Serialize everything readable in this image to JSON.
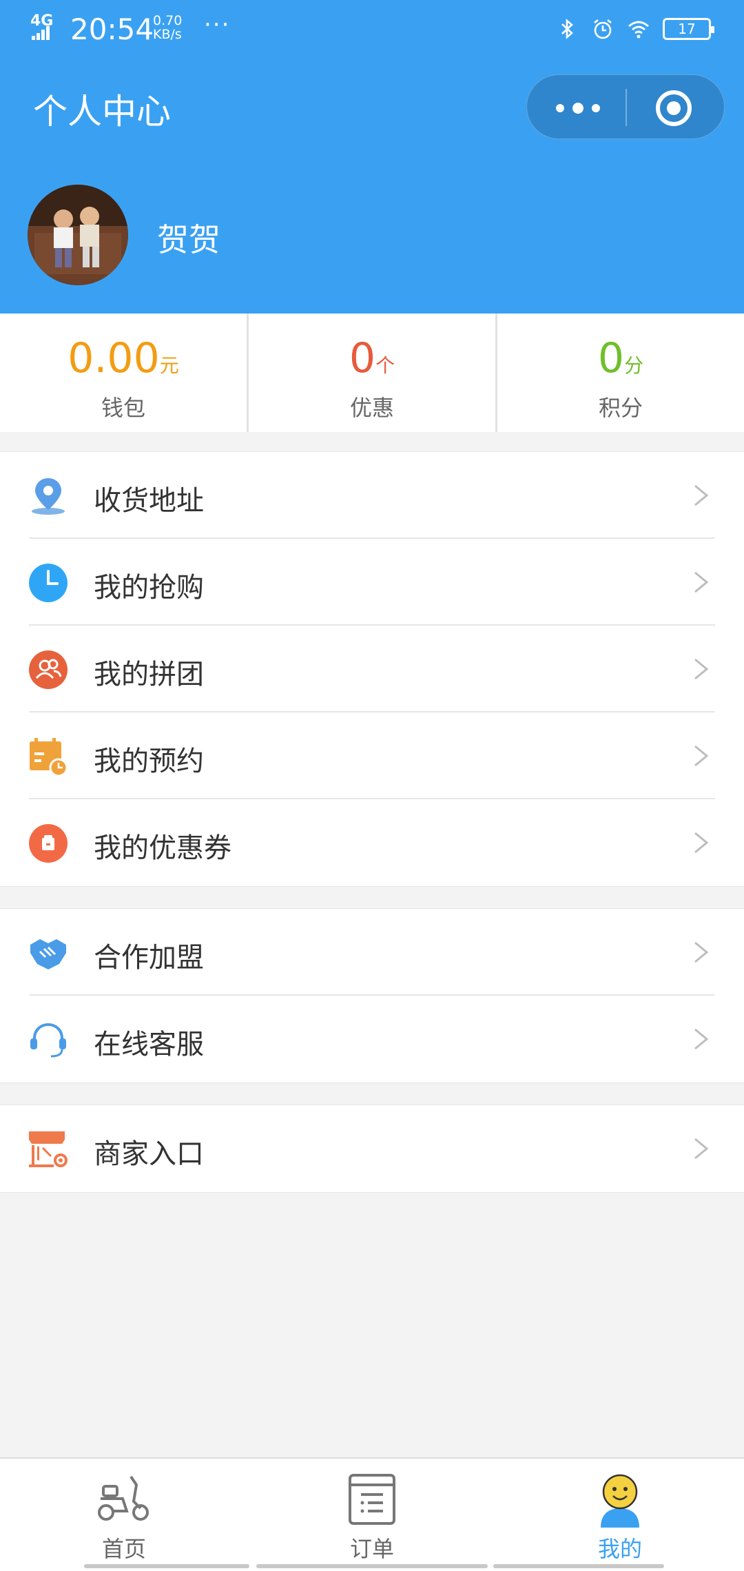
{
  "status_bar": {
    "network": "4G",
    "time": "20:54",
    "speed_value": "0.70",
    "speed_unit": "KB/s",
    "battery": "17",
    "icons": [
      "bluetooth-icon",
      "alarm-icon",
      "wifi-icon",
      "battery-icon"
    ]
  },
  "header": {
    "title": "个人中心",
    "username": "贺贺",
    "background_color": "#3aa1f2"
  },
  "stats": [
    {
      "value": "0.00",
      "unit": "元",
      "label": "钱包",
      "color": "#f39c12"
    },
    {
      "value": "0",
      "unit": "个",
      "label": "优惠",
      "color": "#e85a3c"
    },
    {
      "value": "0",
      "unit": "分",
      "label": "积分",
      "color": "#6fbf2a"
    }
  ],
  "menu_groups": [
    {
      "items": [
        {
          "label": "收货地址",
          "icon": "location-pin-icon"
        },
        {
          "label": "我的抢购",
          "icon": "clock-icon"
        },
        {
          "label": "我的拼团",
          "icon": "group-users-icon"
        },
        {
          "label": "我的预约",
          "icon": "calendar-icon"
        },
        {
          "label": "我的优惠券",
          "icon": "coupon-icon"
        }
      ]
    },
    {
      "items": [
        {
          "label": "合作加盟",
          "icon": "handshake-icon"
        },
        {
          "label": "在线客服",
          "icon": "headset-icon"
        }
      ]
    },
    {
      "items": [
        {
          "label": "商家入口",
          "icon": "shop-settings-icon"
        }
      ]
    }
  ],
  "tabbar": {
    "tabs": [
      {
        "label": "首页",
        "icon": "scooter-icon",
        "active": false
      },
      {
        "label": "订单",
        "icon": "order-list-icon",
        "active": false
      },
      {
        "label": "我的",
        "icon": "smiley-user-icon",
        "active": true
      }
    ]
  }
}
